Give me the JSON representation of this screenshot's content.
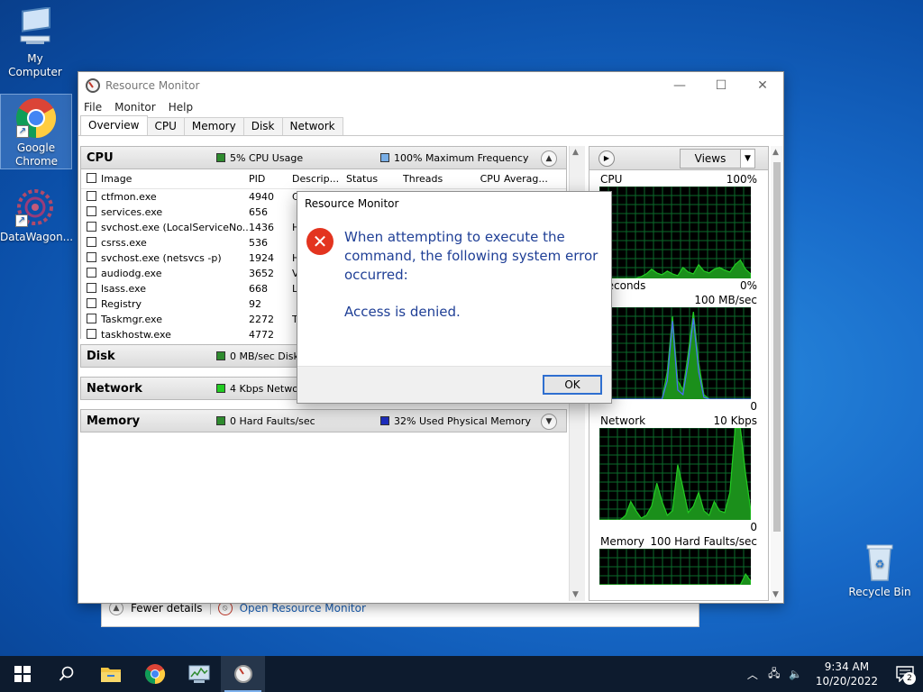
{
  "desktop": {
    "icons": [
      {
        "label": "My Computer"
      },
      {
        "label": "Google Chrome"
      },
      {
        "label": "DataWagon..."
      },
      {
        "label": "Recycle Bin"
      }
    ]
  },
  "background_window": {
    "fewer_details": "Fewer details",
    "open_resource_monitor": "Open Resource Monitor"
  },
  "window": {
    "title": "Resource Monitor",
    "menu": [
      "File",
      "Monitor",
      "Help"
    ],
    "tabs": [
      "Overview",
      "CPU",
      "Memory",
      "Disk",
      "Network"
    ],
    "active_tab": "Overview"
  },
  "cpu_section": {
    "title": "CPU",
    "stat1": "5% CPU Usage",
    "stat2": "100% Maximum Frequency",
    "columns": [
      "Image",
      "PID",
      "Descrip...",
      "Status",
      "Threads",
      "CPU",
      "Averag..."
    ],
    "rows": [
      {
        "image": "ctfmon.exe",
        "pid": "4940",
        "desc": "C"
      },
      {
        "image": "services.exe",
        "pid": "656",
        "desc": ""
      },
      {
        "image": "svchost.exe (LocalServiceNo...",
        "pid": "1436",
        "desc": "H"
      },
      {
        "image": "csrss.exe",
        "pid": "536",
        "desc": ""
      },
      {
        "image": "svchost.exe (netsvcs -p)",
        "pid": "1924",
        "desc": "H"
      },
      {
        "image": "audiodg.exe",
        "pid": "3652",
        "desc": "V"
      },
      {
        "image": "lsass.exe",
        "pid": "668",
        "desc": "L"
      },
      {
        "image": "Registry",
        "pid": "92",
        "desc": ""
      },
      {
        "image": "Taskmgr.exe",
        "pid": "2272",
        "desc": "T"
      },
      {
        "image": "taskhostw.exe",
        "pid": "4772",
        "desc": ""
      }
    ]
  },
  "disk_section": {
    "title": "Disk",
    "stat1": "0 MB/sec Disk"
  },
  "network_section": {
    "title": "Network",
    "stat1": "4 Kbps Netwo"
  },
  "memory_section": {
    "title": "Memory",
    "stat1": "0 Hard Faults/sec",
    "stat2": "32% Used Physical Memory"
  },
  "right_pane": {
    "views_label": "Views",
    "graphs": [
      {
        "name": "CPU",
        "max": "100%",
        "footer_left": "Seconds",
        "footer_right": "0%"
      },
      {
        "name": "k",
        "max": "100 MB/sec",
        "footer_left": "",
        "footer_right": "0"
      },
      {
        "name": "Network",
        "max": "10 Kbps",
        "footer_left": "",
        "footer_right": "0"
      },
      {
        "name": "Memory",
        "max": "100 Hard Faults/sec"
      }
    ]
  },
  "dialog": {
    "title": "Resource Monitor",
    "message": "When attempting to execute the command, the following system error occurred:",
    "detail": "Access is denied.",
    "ok_label": "OK"
  },
  "taskbar": {
    "time": "9:34 AM",
    "date": "10/20/2022",
    "notification_count": "2"
  },
  "colors": {
    "desktop_blue": "#1769c8",
    "taskbar": "#0d1b2e",
    "dialog_text": "#1f3f96",
    "error_red": "#e3341f",
    "graph_green": "#22cc22",
    "graph_blue": "#4a6cff"
  }
}
